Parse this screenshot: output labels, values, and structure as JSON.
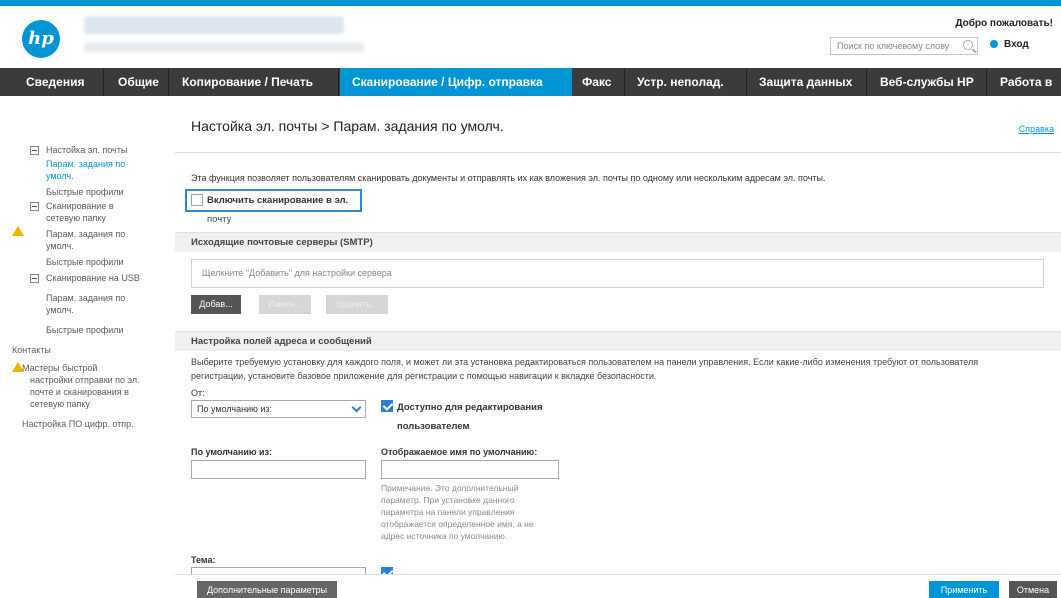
{
  "header": {
    "logo_text": "hp",
    "welcome": "Добро пожаловать!",
    "search_placeholder": "Поиск по ключевому слову",
    "login": "Вход"
  },
  "nav": {
    "items": [
      {
        "label": "Сведения"
      },
      {
        "label": "Общие"
      },
      {
        "label": "Копирование / Печать"
      },
      {
        "label": "Сканирование / Цифр. отправка",
        "active": true
      },
      {
        "label": "Факс"
      },
      {
        "label": "Устр. неполад."
      },
      {
        "label": "Защита данных"
      },
      {
        "label": "Веб-службы HP"
      },
      {
        "label": "Работа в"
      }
    ]
  },
  "sidebar": {
    "email_setup": "Настойка эл. почты",
    "default_job_options_1a": "Парам. задания по",
    "default_job_options_1b": "умолч.",
    "quick_sets_1": "Быстрые профили",
    "scan_network_folder_a": "Сканирование в",
    "scan_network_folder_b": "сетевую папку",
    "default_job_options_2a": "Парам. задания по",
    "default_job_options_2b": "умолч.",
    "quick_sets_2": "Быстрые профили",
    "scan_usb": "Сканирование на USB",
    "default_job_options_3a": "Парам. задания по",
    "default_job_options_3b": "умолч.",
    "quick_sets_3": "Быстрые профили",
    "contacts": "Контакты",
    "wizard_a": "Мастеры быстрой",
    "wizard_b": "настройки отправки по эл.",
    "wizard_c": "почте и сканирования в",
    "wizard_d": "сетевую папку",
    "digital_sending_software": "Настройка ПО цифр. отпр."
  },
  "main": {
    "title": "Настойка эл. почты > Парам. задания по умолч.",
    "help": "Справка",
    "description": "Эта функция позволяет пользователям сканировать документы и отправлять их как вложения эл. почты по одному или нескольким адресам эл. почты.",
    "enable_scan_email_a": "Включить сканирование в эл.",
    "enable_scan_email_b": "почту",
    "smtp_section": "Исходящие почтовые серверы (SMTP)",
    "smtp_placeholder": "Щелкните \"Добавить\" для настройки сервера",
    "btn_add": "Добав...",
    "btn_edit": "Измен...",
    "btn_remove": "Удалить...",
    "address_section": "Настройка полей адреса и сообщений",
    "address_note_1": "Выберите требуемую установку для каждого поля, и может ли эта установка редактироваться пользователем на панели управления. Если какие-либо изменения требуют от пользователя",
    "address_note_2": "регистрации, установите базовое приложение для регистрации с помощью навигации к вкладке безопасности.",
    "from_label": "От:",
    "from_value": "По умолчанию из:",
    "user_editable_a": "Доступно для редактирования",
    "user_editable_b": "пользователем",
    "default_from_label": "По умолчанию из:",
    "display_name_label": "Отображаемое имя по умолчанию:",
    "display_note_1": "Примечание. Это дополнительный",
    "display_note_2": "параметр. При установке данного",
    "display_note_3": "параметра на панели управления",
    "display_note_4": "отображается определенное имя, а не",
    "display_note_5": "адрес источника по умолчанию.",
    "subject_label": "Тема:"
  },
  "footer": {
    "advanced": "Дополнительные параметры",
    "apply": "Применить",
    "cancel": "Отмена"
  },
  "colors": {
    "accent": "#0096d6",
    "nav_bg": "#3b3b3b",
    "highlight": "#2e8bd8"
  }
}
